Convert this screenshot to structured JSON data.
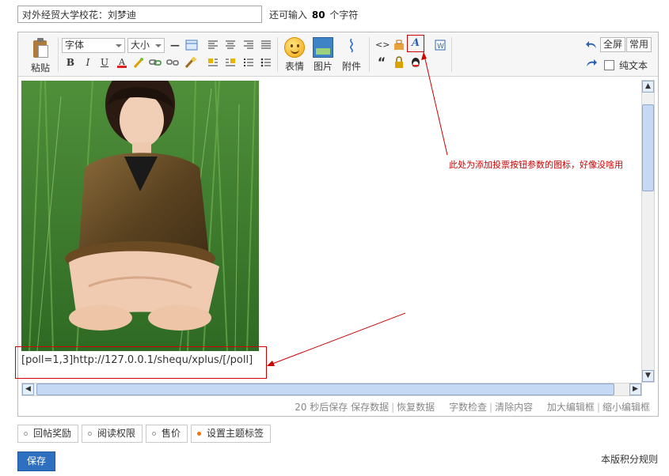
{
  "title_field": {
    "value": "对外经贸大学校花：刘梦迪",
    "hint_prefix": "还可输入",
    "hint_count": "80",
    "hint_suffix": "个字符"
  },
  "toolbar": {
    "paste_label": "粘贴",
    "font_select": "字体",
    "size_select": "大小",
    "emoticon_label": "表情",
    "image_label": "图片",
    "attachment_label": "附件",
    "fullscreen_label": "全屏",
    "common_label": "常用",
    "plain_text_label": "纯文本",
    "bold": "B",
    "italic": "I",
    "underline": "U",
    "quote": "“",
    "code": "<>"
  },
  "content": {
    "poll_text": "[poll=1,3]http://127.0.0.1/shequ/xplus/[/poll]"
  },
  "annotation": {
    "text": "此处为添加投票按钮参数的图标，好像没啥用"
  },
  "statusbar": {
    "autosave": "20 秒后保存",
    "save_data": "保存数据",
    "restore_data": "恢复数据",
    "word_check": "字数检查",
    "clear_content": "清除内容",
    "enlarge_editor": "加大编辑框",
    "shrink_editor": "缩小编辑框"
  },
  "tabs": [
    {
      "label": "回帖奖励"
    },
    {
      "label": "阅读权限"
    },
    {
      "label": "售价"
    },
    {
      "label": "设置主题标签"
    }
  ],
  "footer": {
    "save_label": "保存",
    "rules_link": "本版积分规则"
  },
  "colors": {
    "annotation_red": "#cc0000",
    "save_button_blue": "#2f6fbf",
    "active_tab_dot": "#ff7200"
  }
}
